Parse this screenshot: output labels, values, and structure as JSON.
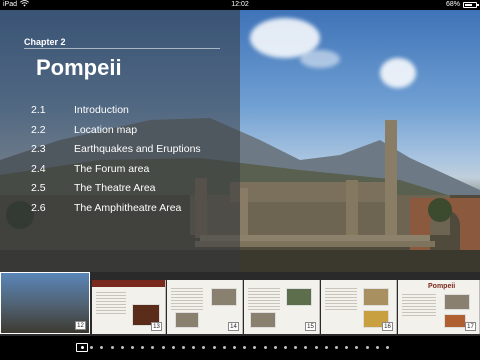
{
  "status_bar": {
    "carrier": "iPad",
    "wifi_icon": "wifi-icon",
    "time": "12:02",
    "battery_percent": "68%",
    "battery_level": 0.68
  },
  "chapter": {
    "label": "Chapter 2",
    "title": "Pompeii",
    "sections": [
      {
        "number": "2.1",
        "title": "Introduction"
      },
      {
        "number": "2.2",
        "title": "Location map"
      },
      {
        "number": "2.3",
        "title": "Earthquakes and Eruptions"
      },
      {
        "number": "2.4",
        "title": "The Forum area"
      },
      {
        "number": "2.5",
        "title": "The Theatre Area"
      },
      {
        "number": "2.6",
        "title": "The Amphitheatre Area"
      }
    ]
  },
  "thumbnails": {
    "page_numbers": [
      "12",
      "13",
      "14",
      "15",
      "16",
      "17"
    ],
    "last_page_heading": "Pompeii"
  },
  "page_indicator": {
    "current_index": 0,
    "total_dots": 31
  }
}
